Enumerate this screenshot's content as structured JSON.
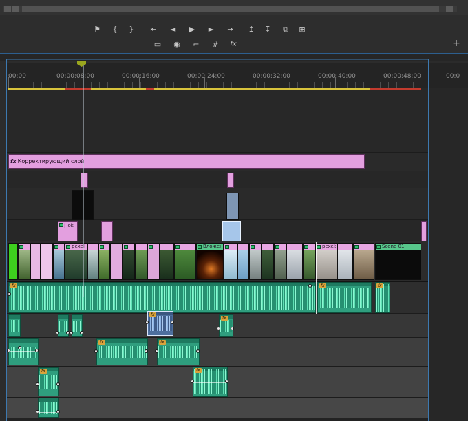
{
  "toolbar": {
    "row1": [
      {
        "name": "add-marker-button",
        "glyph": "⚑"
      },
      {
        "name": "mark-in-button",
        "glyph": "{"
      },
      {
        "name": "mark-out-button",
        "glyph": "}"
      },
      {
        "name": "go-to-in-button",
        "glyph": "⇤"
      },
      {
        "name": "step-back-button",
        "glyph": "◄"
      },
      {
        "name": "play-button",
        "glyph": "▶"
      },
      {
        "name": "step-forward-button",
        "glyph": "►"
      },
      {
        "name": "go-to-out-button",
        "glyph": "⇥"
      },
      {
        "name": "lift-button",
        "glyph": "↥"
      },
      {
        "name": "extract-button",
        "glyph": "↧"
      },
      {
        "name": "duplicate-frame-button",
        "glyph": "⧉"
      },
      {
        "name": "paste-attributes-button",
        "glyph": "⊞"
      }
    ],
    "row2": [
      {
        "name": "safe-margins-button",
        "glyph": "▭"
      },
      {
        "name": "export-frame-button",
        "glyph": "◉"
      },
      {
        "name": "corner-overlay-button",
        "glyph": "⌐"
      },
      {
        "name": "snap-toggle",
        "glyph": "#"
      },
      {
        "name": "fx-badges-toggle",
        "glyph": "fx"
      }
    ],
    "add_button": "+"
  },
  "ruler": {
    "labels": [
      "00;00",
      "00;00;08;00",
      "00;00;16;00",
      "00;00;24;00",
      "00;00;32;00",
      "00;00;40;00",
      "00;00;48;00"
    ],
    "right_partial": "00;0"
  },
  "clips": {
    "adjustment": {
      "fx": "fx",
      "label": "Корректирующий слой"
    },
    "tok": "|Tok",
    "pexel": "pexel",
    "nested": "Вложен",
    "pexels_p": "pexels-p",
    "scene01": "Scene 01"
  },
  "badges": {
    "audio_fx": "fx"
  },
  "colors": {
    "accent_blue": "#3d79b0",
    "clip_pink": "#e39fdf",
    "clip_green": "#57c78b",
    "audio_teal": "#2f9e7e",
    "render_yellow": "#d8c33c",
    "render_red": "#c23b2e"
  }
}
